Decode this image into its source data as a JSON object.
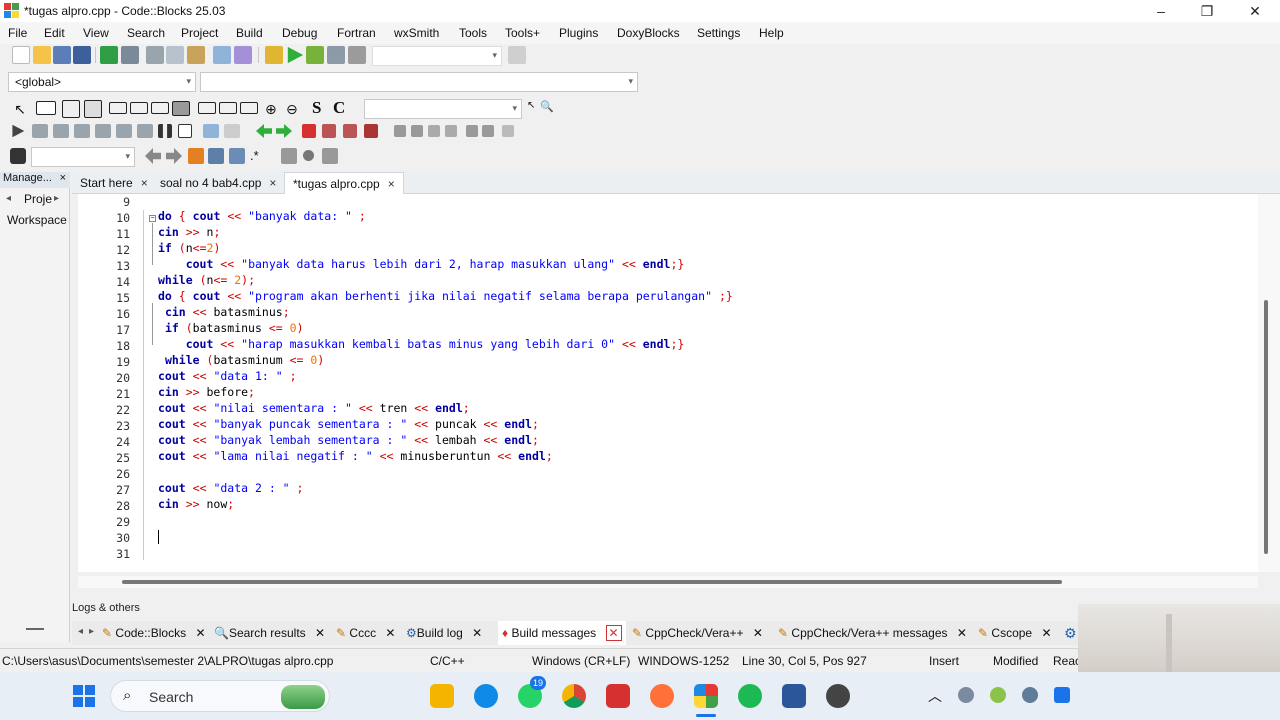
{
  "window": {
    "title": "*tugas alpro.cpp - Code::Blocks 25.03",
    "controls": [
      "–",
      "❐",
      "✕"
    ]
  },
  "menu": [
    "File",
    "Edit",
    "View",
    "Search",
    "Project",
    "Build",
    "Debug",
    "Fortran",
    "wxSmith",
    "Tools",
    "Tools+",
    "Plugins",
    "DoxyBlocks",
    "Settings",
    "Help"
  ],
  "scope": {
    "selected": "<global>",
    "function": ""
  },
  "toolbar": {
    "find_value": "",
    "jump_value": "",
    "text_buttons": [
      "S",
      "C"
    ]
  },
  "left_panel": {
    "header": "Manage...",
    "close": "×",
    "tab": "Proje",
    "item": "Workspace"
  },
  "editor_tabs": [
    {
      "label": "Start here",
      "close": "×"
    },
    {
      "label": "soal no 4 bab4.cpp",
      "close": "×"
    },
    {
      "label": "*tugas alpro.cpp",
      "close": "×"
    }
  ],
  "code": {
    "line_numbers": [
      "9",
      "10",
      "11",
      "12",
      "13",
      "14",
      "15",
      "16",
      "17",
      "18",
      "19",
      "20",
      "21",
      "22",
      "23",
      "24",
      "25",
      "26",
      "27",
      "28",
      "29",
      "30",
      "31"
    ]
  },
  "logs": {
    "header": "Logs & others",
    "tabs": [
      {
        "label": "Code::Blocks",
        "icon": "document-icon"
      },
      {
        "label": "Search results",
        "icon": "search-icon"
      },
      {
        "label": "Cccc",
        "icon": "document-icon"
      },
      {
        "label": "Build log",
        "icon": "gear-icon"
      },
      {
        "label": "Build messages",
        "icon": "marker-icon"
      },
      {
        "label": "CppCheck/Vera++",
        "icon": "document-icon"
      },
      {
        "label": "CppCheck/Vera++ messages",
        "icon": "document-icon"
      },
      {
        "label": "Cscope",
        "icon": "document-icon"
      }
    ],
    "close": "✕"
  },
  "status": {
    "path": "C:\\Users\\asus\\Documents\\semester 2\\ALPRO\\tugas alpro.cpp",
    "language": "C/C++",
    "eol": "Windows (CR+LF)",
    "encoding": "WINDOWS-1252",
    "position": "Line 30, Col 5, Pos 927",
    "mode": "Insert",
    "state": "Modified",
    "extra": "Reac"
  },
  "taskbar": {
    "search_placeholder": "Search",
    "whatsapp_badge": "19"
  },
  "colors": {
    "keyword": "#0000a0",
    "string": "#0000ff",
    "operator": "#d00000",
    "number": "#f07000",
    "taskbar": "#e8eef5"
  }
}
